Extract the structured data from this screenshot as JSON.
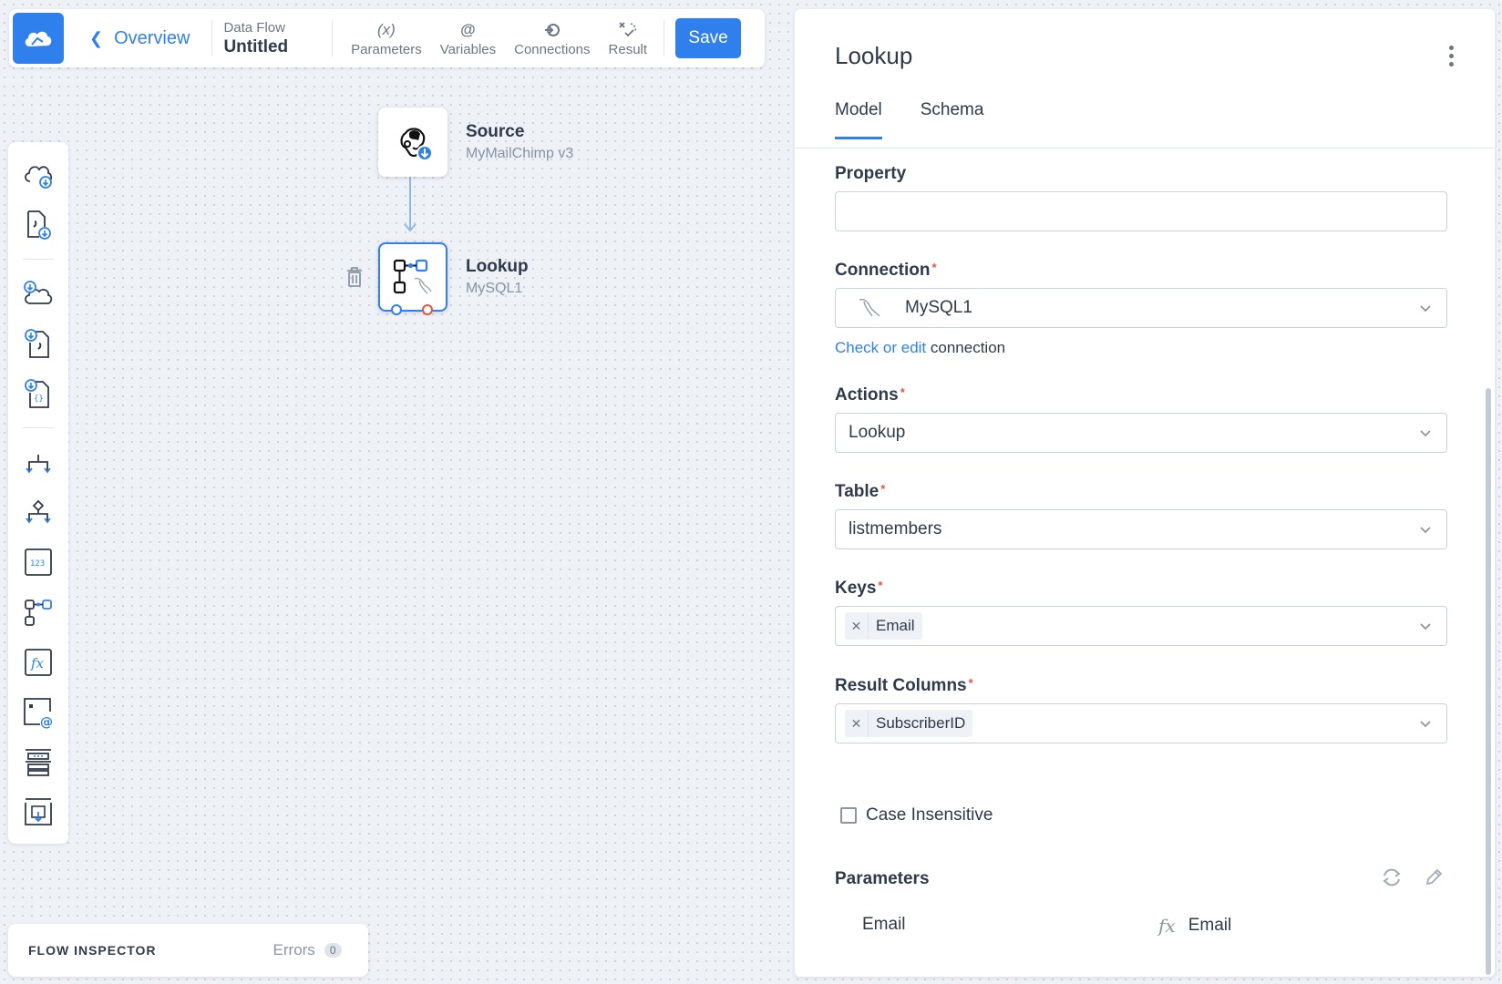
{
  "toolbar": {
    "back_label": "Overview",
    "flow_type": "Data Flow",
    "flow_name": "Untitled",
    "parameters": {
      "icon": "(x)",
      "label": "Parameters"
    },
    "variables": {
      "icon": "@",
      "label": "Variables"
    },
    "connections": {
      "label": "Connections"
    },
    "result": {
      "label": "Result"
    },
    "save_label": "Save"
  },
  "canvas": {
    "source": {
      "title": "Source",
      "subtitle": "MyMailChimp v3"
    },
    "lookup": {
      "title": "Lookup",
      "subtitle": "MySQL1"
    }
  },
  "inspector": {
    "title": "FLOW INSPECTOR",
    "errors_label": "Errors",
    "errors_count": "0"
  },
  "panel": {
    "title": "Lookup",
    "tabs": [
      "Model",
      "Schema"
    ],
    "property_label": "Property",
    "property_value": "",
    "connection_label": "Connection",
    "connection_value": "MySQL1",
    "check_link": "Check or edit",
    "check_suffix": " connection",
    "actions_label": "Actions",
    "actions_value": "Lookup",
    "table_label": "Table",
    "table_value": "listmembers",
    "keys_label": "Keys",
    "keys_chip": "Email",
    "result_columns_label": "Result Columns",
    "result_columns_chip": "SubscriberID",
    "case_insensitive_label": "Case Insensitive",
    "parameters_label": "Parameters",
    "param_name": "Email",
    "param_fx": "fx",
    "param_value": "Email"
  },
  "colors": {
    "accent": "#2f80ed",
    "required": "#e5533d",
    "port_red": "#e5533d"
  }
}
